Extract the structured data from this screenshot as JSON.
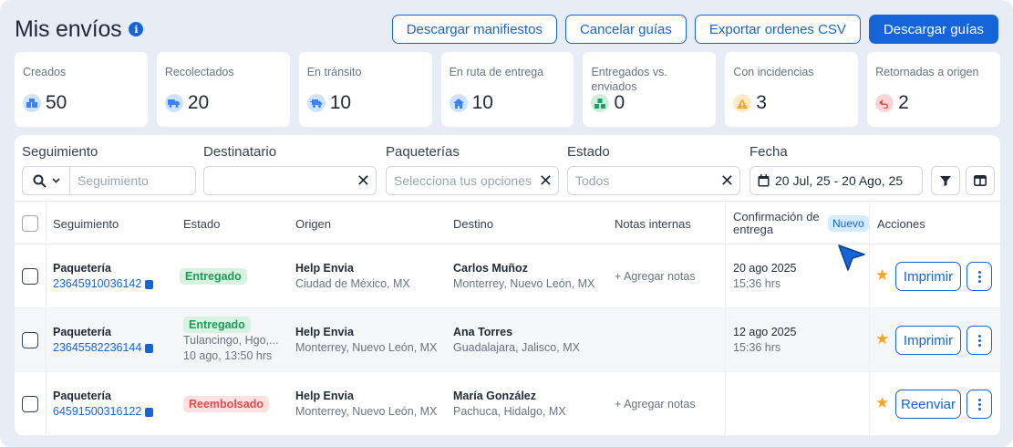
{
  "header": {
    "title": "Mis envíos",
    "info_icon": "info-icon",
    "actions": {
      "download_manifests": "Descargar manifiestos",
      "cancel_guides": "Cancelar guías",
      "export_csv": "Exportar ordenes CSV",
      "download_guides": "Descargar guías"
    }
  },
  "stats": [
    {
      "label": "Creados",
      "value": "50",
      "icon": "boxes-icon",
      "color": "#3b82f6"
    },
    {
      "label": "Recolectados",
      "value": "20",
      "icon": "truck-icon",
      "color": "#3b82f6"
    },
    {
      "label": "En tránsito",
      "value": "10",
      "icon": "fast-truck-icon",
      "color": "#3b82f6"
    },
    {
      "label": "En ruta de entrega",
      "value": "10",
      "icon": "home-icon",
      "color": "#3b82f6"
    },
    {
      "label": "Entregados vs. enviados",
      "value": "0",
      "icon": "boxes-delivered-icon",
      "color": "#22a06b"
    },
    {
      "label": "Con incidencias",
      "value": "3",
      "icon": "warning-icon",
      "color": "#f5a524"
    },
    {
      "label": "Retornadas a origen",
      "value": "2",
      "icon": "return-icon",
      "color": "#e24c4c"
    }
  ],
  "filters": {
    "tracking": {
      "label": "Seguimiento",
      "placeholder": "Seguimiento"
    },
    "recipient": {
      "label": "Destinatario",
      "placeholder": ""
    },
    "carriers": {
      "label": "Paqueterías",
      "placeholder": "Selecciona tus opciones"
    },
    "status": {
      "label": "Estado",
      "value": "Todos"
    },
    "date": {
      "label": "Fecha",
      "value": "20 Jul, 25 - 20 Ago, 25"
    }
  },
  "table": {
    "headers": {
      "tracking": "Seguimiento",
      "status": "Estado",
      "origin": "Origen",
      "destination": "Destino",
      "notes": "Notas internas",
      "confirmation": "Confirmación de entrega",
      "new_badge": "Nuevo",
      "actions": "Acciones"
    },
    "rows": [
      {
        "carrier": "Paquetería",
        "tracking_number": "23645910036142",
        "status": "Entregado",
        "status_detail": "",
        "status_time": "",
        "origin_name": "Help Envia",
        "origin_place": "Ciudad de México, MX",
        "dest_name": "Carlos Muñoz",
        "dest_place": "Monterrey, Nuevo León, MX",
        "notes": "+ Agregar notas",
        "confirm_date": "20 ago 2025",
        "confirm_time": "15:36 hrs",
        "action": "Imprimir"
      },
      {
        "carrier": "Paquetería",
        "tracking_number": "23645582236144",
        "status": "Entregado",
        "status_detail": "Tulancingo, Hgo,...",
        "status_time": "10 ago, 13:50 hrs",
        "origin_name": "Help Envia",
        "origin_place": "Monterrey, Nuevo León, MX",
        "dest_name": "Ana Torres",
        "dest_place": "Guadalajara, Jalisco, MX",
        "notes": "",
        "confirm_date": "12 ago 2025",
        "confirm_time": "15:36 hrs",
        "action": "Imprimir"
      },
      {
        "carrier": "Paquetería",
        "tracking_number": "64591500316122",
        "status": "Reembolsado",
        "status_detail": "",
        "status_time": "",
        "origin_name": "Help Envia",
        "origin_place": "Monterrey, Nuevo León, MX",
        "dest_name": "María González",
        "dest_place": "Pachuca, Hidalgo, MX",
        "notes": "+ Agregar notas",
        "confirm_date": "",
        "confirm_time": "",
        "action": "Reenviar"
      }
    ]
  },
  "colors": {
    "primary": "#1565d8",
    "success": "#1f9a57",
    "danger": "#e24c4c",
    "warning": "#f5a524"
  }
}
